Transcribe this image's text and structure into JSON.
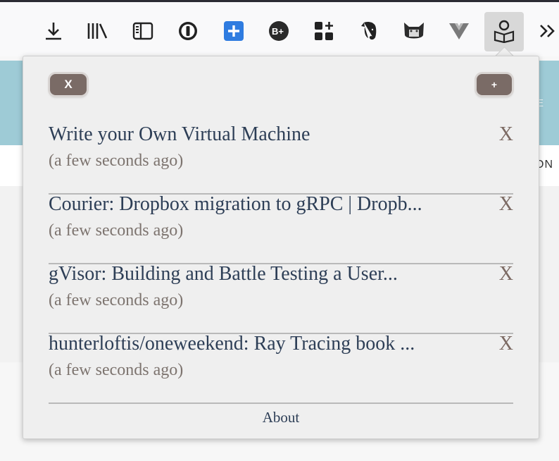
{
  "toolbar": {
    "icons": [
      "download-icon",
      "library-icon",
      "sidebar-icon",
      "onepassword-icon",
      "add-bookmark-icon",
      "b-plus-icon",
      "tab-grid-icon",
      "evernote-icon",
      "cat-icon",
      "vue-icon",
      "reading-list-icon",
      "overflow-menu-icon"
    ],
    "active_icon": "reading-list-icon"
  },
  "background_page": {
    "peek_text_1": "E",
    "peek_text_2": "ON"
  },
  "popup": {
    "close_all_label": "X",
    "add_label": "+",
    "items": [
      {
        "title": "Write your Own Virtual Machine",
        "time": "(a few seconds ago)",
        "remove_label": "X"
      },
      {
        "title": "Courier: Dropbox migration to gRPC | Dropb...",
        "time": "(a few seconds ago)",
        "remove_label": "X"
      },
      {
        "title": "gVisor: Building and Battle Testing a User...",
        "time": "(a few seconds ago)",
        "remove_label": "X"
      },
      {
        "title": "hunterloftis/oneweekend: Ray Tracing book ...",
        "time": "(a few seconds ago)",
        "remove_label": "X"
      }
    ],
    "about_label": "About"
  },
  "colors": {
    "pill": "#7a6b66",
    "title_text": "#2d3e56",
    "time_text": "#7d746f",
    "remove_x": "#7c6a63",
    "page_band": "#9ecbd6"
  }
}
